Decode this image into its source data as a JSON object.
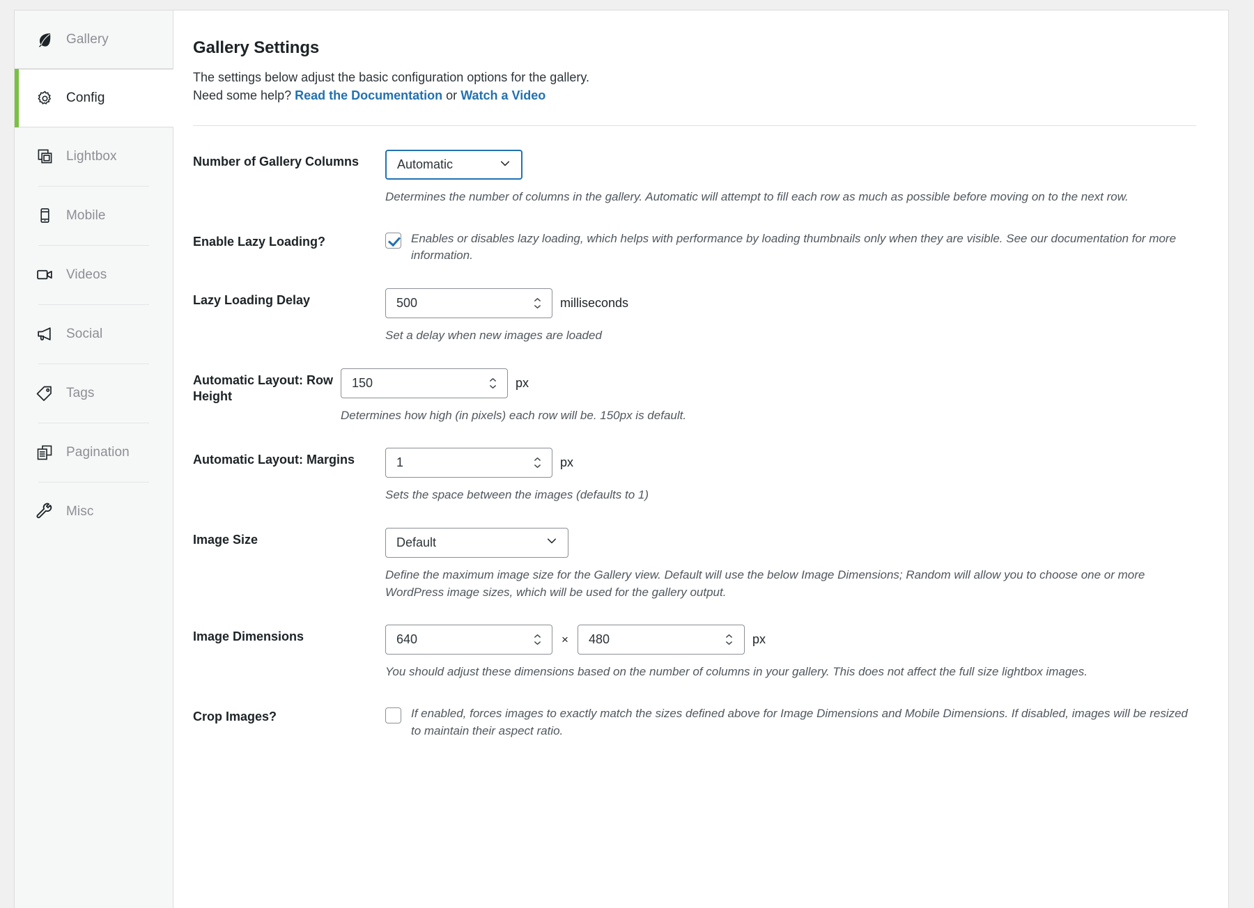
{
  "sidebar": {
    "items": [
      {
        "label": "Gallery",
        "icon": "leaf-icon",
        "active": false
      },
      {
        "label": "Config",
        "icon": "gear-icon",
        "active": true
      },
      {
        "label": "Lightbox",
        "icon": "layers-icon",
        "active": false
      },
      {
        "label": "Mobile",
        "icon": "mobile-icon",
        "active": false
      },
      {
        "label": "Videos",
        "icon": "video-icon",
        "active": false
      },
      {
        "label": "Social",
        "icon": "megaphone-icon",
        "active": false
      },
      {
        "label": "Tags",
        "icon": "tag-icon",
        "active": false
      },
      {
        "label": "Pagination",
        "icon": "pagination-icon",
        "active": false
      },
      {
        "label": "Misc",
        "icon": "wrench-icon",
        "active": false
      }
    ]
  },
  "header": {
    "title": "Gallery Settings",
    "desc_line1": "The settings below adjust the basic configuration options for the gallery.",
    "help_prefix": "Need some help?",
    "link_docs": "Read the Documentation",
    "link_sep": "or",
    "link_video": "Watch a Video"
  },
  "fields": {
    "columns": {
      "label": "Number of Gallery Columns",
      "value": "Automatic",
      "desc": "Determines the number of columns in the gallery. Automatic will attempt to fill each row as much as possible before moving on to the next row."
    },
    "lazy_loading": {
      "label": "Enable Lazy Loading?",
      "checked": true,
      "desc": "Enables or disables lazy loading, which helps with performance by loading thumbnails only when they are visible. See our documentation for more information."
    },
    "lazy_delay": {
      "label": "Lazy Loading Delay",
      "value": "500",
      "unit": "milliseconds",
      "desc": "Set a delay when new images are loaded"
    },
    "row_height": {
      "label": "Automatic Layout: Row Height",
      "value": "150",
      "unit": "px",
      "desc": "Determines how high (in pixels) each row will be. 150px is default."
    },
    "margins": {
      "label": "Automatic Layout: Margins",
      "value": "1",
      "unit": "px",
      "desc": "Sets the space between the images (defaults to 1)"
    },
    "image_size": {
      "label": "Image Size",
      "value": "Default",
      "desc": "Define the maximum image size for the Gallery view. Default will use the below Image Dimensions; Random will allow you to choose one or more WordPress image sizes, which will be used for the gallery output."
    },
    "image_dimensions": {
      "label": "Image Dimensions",
      "width": "640",
      "height": "480",
      "separator": "×",
      "unit": "px",
      "desc": "You should adjust these dimensions based on the number of columns in your gallery. This does not affect the full size lightbox images."
    },
    "crop_images": {
      "label": "Crop Images?",
      "checked": false,
      "desc": "If enabled, forces images to exactly match the sizes defined above for Image Dimensions and Mobile Dimensions. If disabled, images will be resized to maintain their aspect ratio."
    }
  },
  "colors": {
    "accent_green": "#7ac143",
    "link_blue": "#2271b1",
    "focus_blue": "#2271b1",
    "sidebar_bg": "#f6f7f7",
    "page_bg": "#f0f0f1"
  }
}
